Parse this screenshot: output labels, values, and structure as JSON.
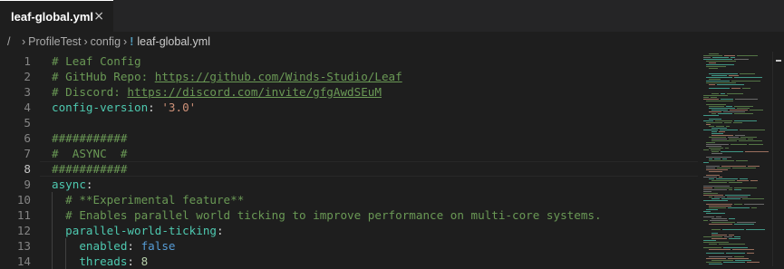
{
  "tab": {
    "label": "leaf-global.yml",
    "close_glyph": "×"
  },
  "breadcrumb": {
    "lead": "/",
    "segments": [
      "ProfileTest",
      "config"
    ],
    "separator": "›",
    "file_icon_glyph": "!",
    "current": "leaf-global.yml"
  },
  "editor": {
    "active_line": 8,
    "lines": [
      {
        "n": "1",
        "tokens": [
          {
            "t": "# Leaf Config",
            "c": "c-comment"
          }
        ]
      },
      {
        "n": "2",
        "tokens": [
          {
            "t": "# GitHub Repo: ",
            "c": "c-comment"
          },
          {
            "t": "https://github.com/Winds-Studio/Leaf",
            "c": "c-link"
          }
        ]
      },
      {
        "n": "3",
        "tokens": [
          {
            "t": "# Discord: ",
            "c": "c-comment"
          },
          {
            "t": "https://discord.com/invite/gfgAwdSEuM",
            "c": "c-link"
          }
        ]
      },
      {
        "n": "4",
        "tokens": [
          {
            "t": "config-version",
            "c": "c-key"
          },
          {
            "t": ": ",
            "c": "c-punct"
          },
          {
            "t": "'3.0'",
            "c": "c-str"
          }
        ]
      },
      {
        "n": "5",
        "tokens": []
      },
      {
        "n": "6",
        "tokens": [
          {
            "t": "###########",
            "c": "c-comment"
          }
        ]
      },
      {
        "n": "7",
        "tokens": [
          {
            "t": "#  ASYNC  #",
            "c": "c-comment"
          }
        ]
      },
      {
        "n": "8",
        "tokens": [
          {
            "t": "###########",
            "c": "c-comment"
          }
        ]
      },
      {
        "n": "9",
        "tokens": [
          {
            "t": "async",
            "c": "c-key"
          },
          {
            "t": ":",
            "c": "c-punct"
          }
        ]
      },
      {
        "n": "10",
        "tokens": [
          {
            "t": "  "
          },
          {
            "t": "# **Experimental feature**",
            "c": "c-comment"
          }
        ]
      },
      {
        "n": "11",
        "tokens": [
          {
            "t": "  "
          },
          {
            "t": "# Enables parallel world ticking to improve performance on multi-core systems.",
            "c": "c-comment"
          }
        ]
      },
      {
        "n": "12",
        "tokens": [
          {
            "t": "  "
          },
          {
            "t": "parallel-world-ticking",
            "c": "c-key"
          },
          {
            "t": ":",
            "c": "c-punct"
          }
        ]
      },
      {
        "n": "13",
        "tokens": [
          {
            "t": "    "
          },
          {
            "t": "enabled",
            "c": "c-key"
          },
          {
            "t": ": ",
            "c": "c-punct"
          },
          {
            "t": "false",
            "c": "c-bool"
          }
        ]
      },
      {
        "n": "14",
        "tokens": [
          {
            "t": "    "
          },
          {
            "t": "threads",
            "c": "c-key"
          },
          {
            "t": ": ",
            "c": "c-punct"
          },
          {
            "t": "8",
            "c": "c-num"
          }
        ]
      }
    ]
  },
  "colors": {
    "editor_bg": "#1e1e1e",
    "tabbar_bg": "#252526",
    "comment": "#6a9955",
    "key": "#4ec9b0",
    "string": "#ce9178",
    "boolean": "#569cd6",
    "number": "#b5cea8"
  },
  "icons": {
    "tab_close": "close-icon",
    "breadcrumb_file": "yaml-file-icon"
  }
}
